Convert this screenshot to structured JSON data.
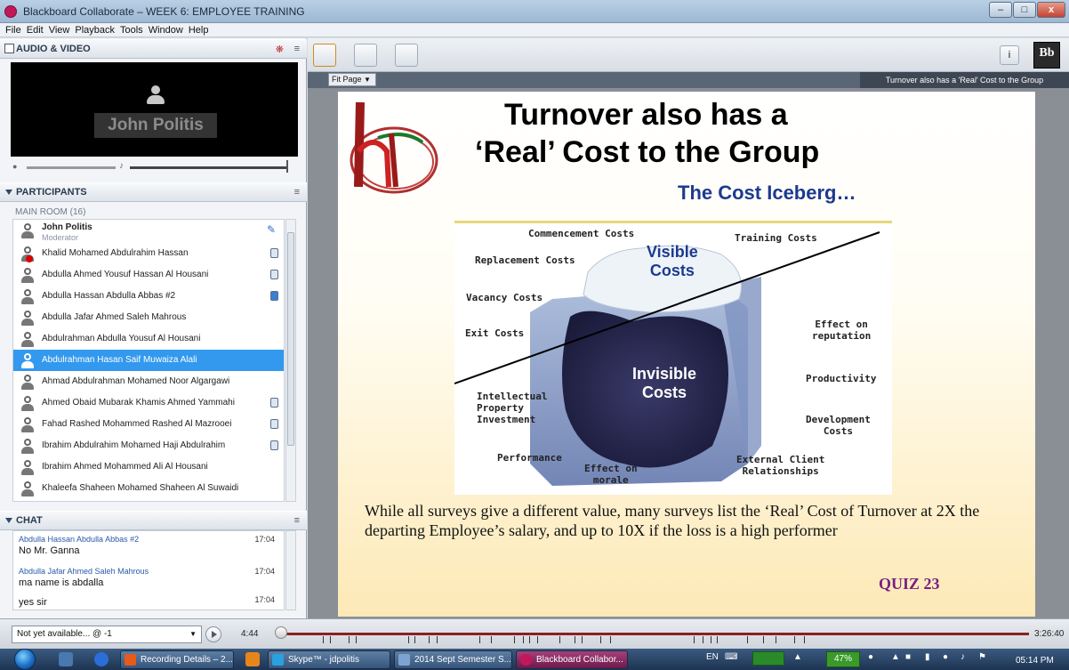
{
  "window": {
    "title": "Blackboard Collaborate – WEEK 6: EMPLOYEE TRAINING"
  },
  "menu": [
    "File",
    "Edit",
    "View",
    "Playback",
    "Tools",
    "Window",
    "Help"
  ],
  "av": {
    "header": "AUDIO & VIDEO",
    "speaker_name": "John Politis"
  },
  "participants": {
    "header": "PARTICIPANTS",
    "room_label": "MAIN ROOM (16)",
    "moderator_name": "John Politis",
    "moderator_role": "Moderator",
    "rows": [
      {
        "name": "Khalid Mohamed Abdulrahim Hassan"
      },
      {
        "name": "Abdulla Ahmed Yousuf Hassan Al Housani"
      },
      {
        "name": "Abdulla Hassan Abdulla Abbas #2"
      },
      {
        "name": "Abdulla Jafar Ahmed Saleh Mahrous"
      },
      {
        "name": "Abdulrahman Abdulla Yousuf Al Housani"
      },
      {
        "name": "Abdulrahman Hasan Saif Muwaiza Alali"
      },
      {
        "name": "Ahmad Abdulrahman Mohamed Noor Algargawi"
      },
      {
        "name": "Ahmed Obaid Mubarak Khamis Ahmed Yammahi"
      },
      {
        "name": "Fahad Rashed Mohammed Rashed Al Mazrooei"
      },
      {
        "name": "Ibrahim Abdulrahim Mohamed Haji Abdulrahim"
      },
      {
        "name": "Ibrahim Ahmed Mohammed Ali Al Housani"
      },
      {
        "name": "Khaleefa Shaheen Mohamed Shaheen Al Suwaidi"
      }
    ]
  },
  "chat": {
    "header": "CHAT",
    "messages": [
      {
        "sender": "Abdulla Hassan Abdulla Abbas #2",
        "time": "17:04",
        "text": "No Mr. Ganna"
      },
      {
        "sender": "Abdulla Jafar Ahmed Saleh Mahrous",
        "time": "17:04",
        "text": "ma name is abdalla"
      },
      {
        "sender": "",
        "time": "17:04",
        "text": "yes sir"
      }
    ]
  },
  "whiteboard": {
    "fit_label": "Fit Page",
    "slide_tab_title": "Turnover also has a 'Real' Cost to the Group"
  },
  "slide": {
    "title_line1": "Turnover also has a",
    "title_line2": "‘Real’ Cost to the Group",
    "subtitle": "The Cost Iceberg…",
    "iceberg": {
      "commencement": "Commencement Costs",
      "training": "Training Costs",
      "replacement": "Replacement Costs",
      "visible": "Visible\nCosts",
      "vacancy": "Vacancy Costs",
      "reputation": "Effect on\nreputation",
      "exit": "Exit Costs",
      "invisible": "Invisible\nCosts",
      "productivity": "Productivity",
      "intellectual": "Intellectual\nProperty\nInvestment",
      "development": "Development\nCosts",
      "performance": "Performance",
      "external": "External Client\nRelationships",
      "morale": "Effect on\nmorale"
    },
    "body": "While all surveys give a different value, many surveys list the ‘Real’ Cost of Turnover at 2X the departing Employee’s salary, and up to 10X if the loss is a high performer",
    "quiz": "QUIZ 23"
  },
  "playback": {
    "recording_select": "Not yet available... @ -1",
    "current_time": "4:44",
    "total_time": "3:26:40"
  },
  "taskbar": {
    "buttons": [
      "Recording Details – 2...",
      "Skype™ - jdpolitis",
      "2014 Sept Semester S...",
      "Blackboard Collabor..."
    ],
    "lang": "EN",
    "battery": "47%",
    "clock": "05:14 PM"
  },
  "colors": {
    "accent": "#3399ee",
    "slide_title": "#000000",
    "subtitle": "#1d3a8f",
    "quiz": "#7b1f82"
  }
}
